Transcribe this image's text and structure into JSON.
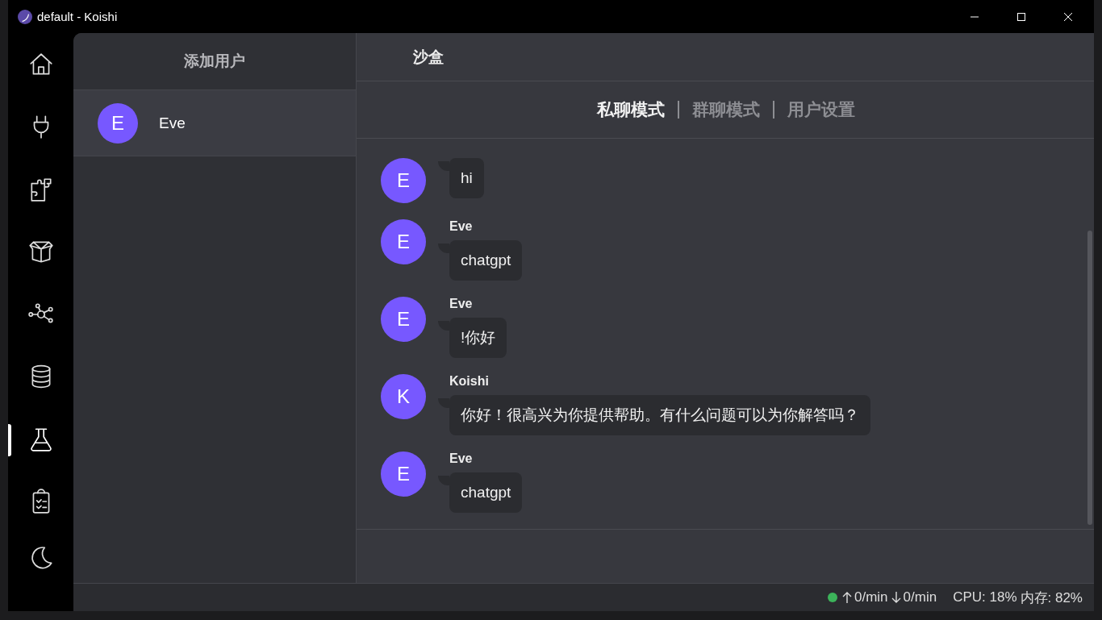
{
  "window": {
    "title": "default - Koishi"
  },
  "sidebar": {
    "items": [
      {
        "kind": "home",
        "selected": false
      },
      {
        "kind": "plug",
        "selected": false
      },
      {
        "kind": "puzzle",
        "selected": false
      },
      {
        "kind": "box",
        "selected": false
      },
      {
        "kind": "network",
        "selected": false
      },
      {
        "kind": "database",
        "selected": false
      },
      {
        "kind": "flask",
        "selected": true
      },
      {
        "kind": "clipboard",
        "selected": false
      }
    ],
    "bottom": {
      "kind": "moon"
    }
  },
  "users": {
    "add_label": "添加用户",
    "items": [
      {
        "avatar": "E",
        "name": "Eve",
        "selected": true
      }
    ]
  },
  "sandbox": {
    "title": "沙盒",
    "tabs": [
      {
        "label": "私聊模式",
        "selected": true
      },
      {
        "label": "群聊模式",
        "selected": false
      },
      {
        "label": "用户设置",
        "selected": false
      }
    ],
    "messages": [
      {
        "avatar": "E",
        "text": "hi"
      },
      {
        "avatar": "E",
        "name": "Eve",
        "text": "chatgpt"
      },
      {
        "avatar": "E",
        "name": "Eve",
        "text": "!你好"
      },
      {
        "avatar": "K",
        "name": "Koishi",
        "text": "你好！很高兴为你提供帮助。有什么问题可以为你解答吗？"
      },
      {
        "avatar": "E",
        "name": "Eve",
        "text": "chatgpt"
      }
    ]
  },
  "status_bar": {
    "online": true,
    "sent": "0/min",
    "received": "0/min",
    "cpu": "CPU: 18%",
    "memory": "内存: 82%"
  }
}
